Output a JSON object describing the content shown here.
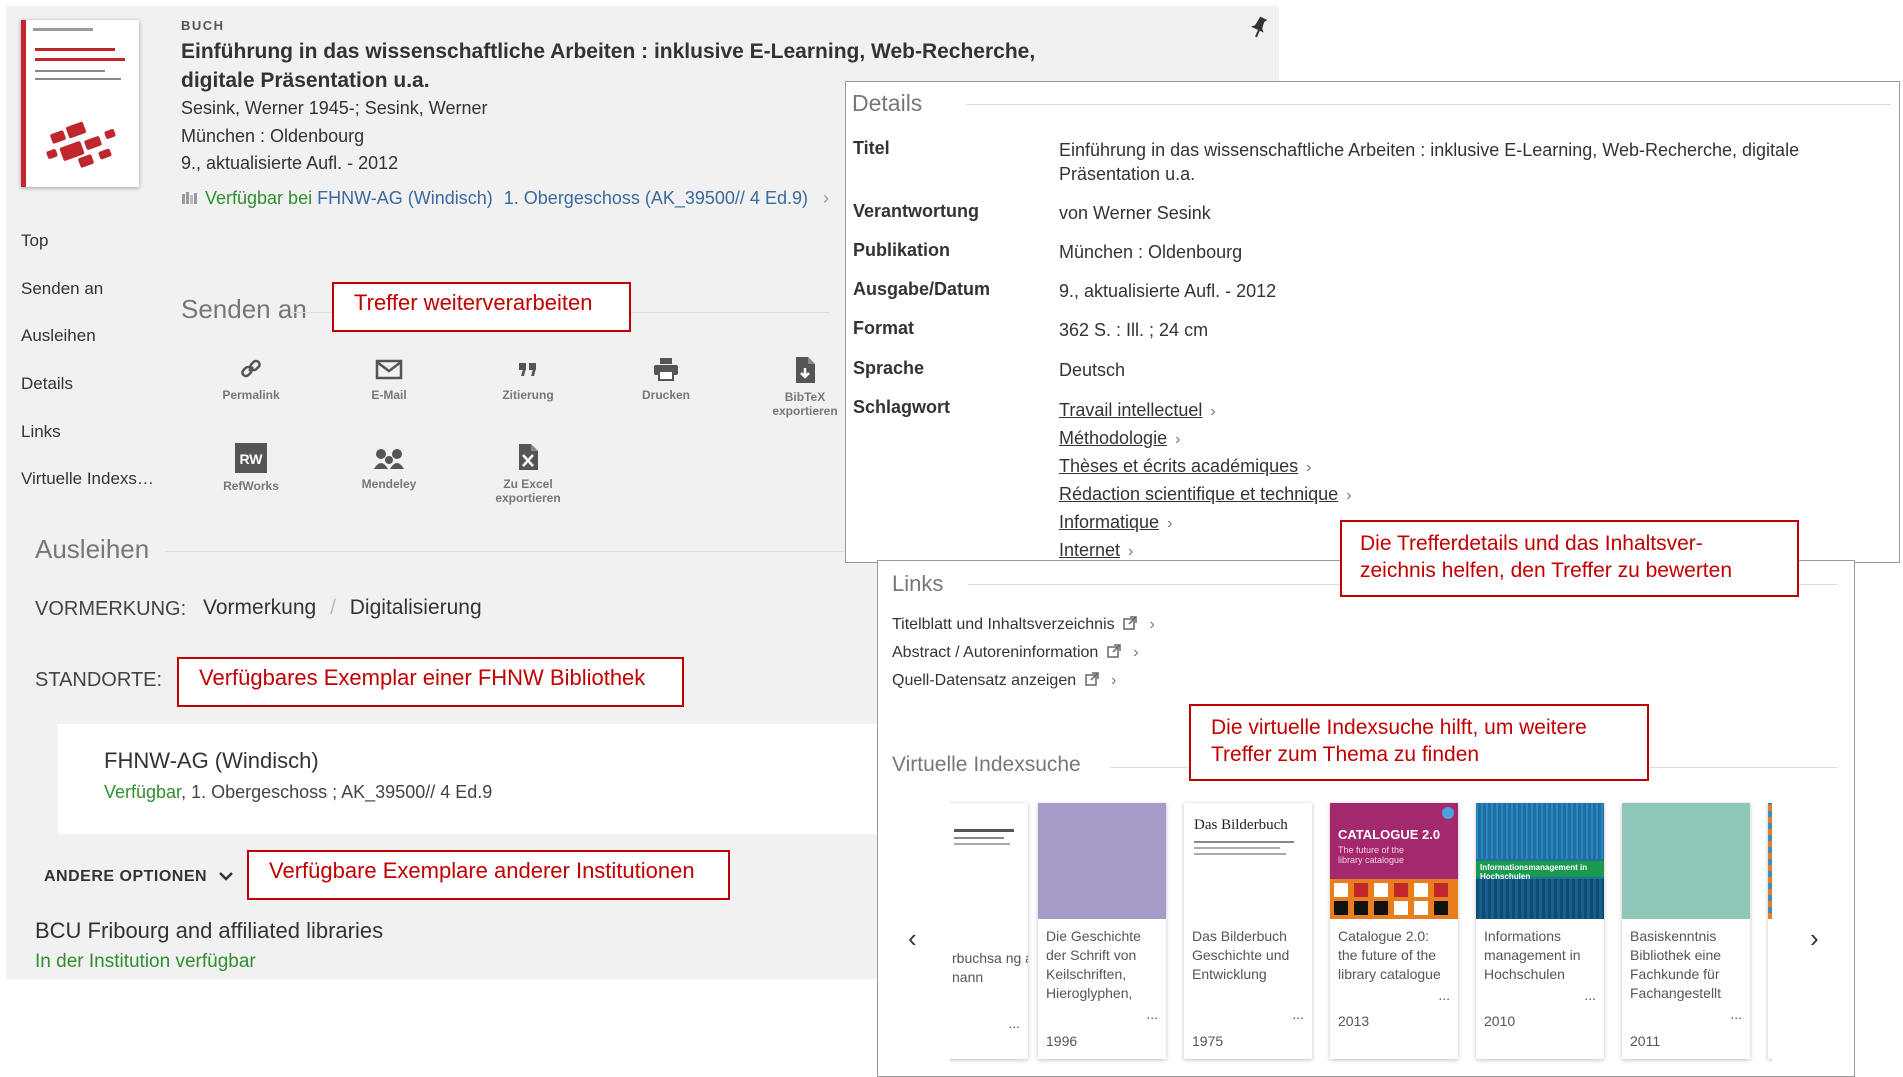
{
  "record": {
    "doc_type": "BUCH",
    "title": "Einführung in das wissenschaftliche Arbeiten : inklusive E-Learning, Web-Recherche, digitale Präsentation u.a.",
    "author": "Sesink, Werner 1945-; Sesink, Werner",
    "place": "München : Oldenbourg",
    "edition": "9., aktualisierte Aufl. - 2012",
    "availability": {
      "status": "Verfügbar bei",
      "library": "FHNW-AG (Windisch)",
      "location": "1. Obergeschoss (AK_39500// 4 Ed.9)"
    }
  },
  "nav": [
    "Top",
    "Senden an",
    "Ausleihen",
    "Details",
    "Links",
    "Virtuelle Indexs…"
  ],
  "send": {
    "heading": "Senden an",
    "actions": [
      {
        "label": "Permalink",
        "icon": "link-icon"
      },
      {
        "label": "E-Mail",
        "icon": "mail-icon"
      },
      {
        "label": "Zitierung",
        "icon": "quote-icon"
      },
      {
        "label": "Drucken",
        "icon": "print-icon"
      },
      {
        "label": "BibTeX",
        "label2": "exportieren",
        "icon": "bibtex-file-icon"
      },
      {
        "label": "RefWorks",
        "icon": "refworks-icon"
      },
      {
        "label": "Mendeley",
        "icon": "mendeley-icon"
      },
      {
        "label": "Zu Excel",
        "label2": "exportieren",
        "icon": "excel-file-icon"
      }
    ]
  },
  "lend": {
    "heading": "Ausleihen",
    "vormerkung_label": "VORMERKUNG:",
    "vormerkung": "Vormerkung",
    "digitalisierung": "Digitalisierung",
    "standorte_label": "STANDORTE:",
    "location_name": "FHNW-AG (Windisch)",
    "location_status": "Verfügbar",
    "location_detail": ", 1. Obergeschoss ; AK_39500// 4 Ed.9",
    "other_options": "ANDERE OPTIONEN",
    "other_library": "BCU Fribourg and affiliated libraries",
    "other_status": "In der Institution verfügbar"
  },
  "details": {
    "heading": "Details",
    "rows": [
      {
        "label": "Titel",
        "value": "Einführung in das wissenschaftliche Arbeiten : inklusive E-Learning, Web-Recherche, digitale Präsentation u.a."
      },
      {
        "label": "Verantwortung",
        "value": "von Werner Sesink"
      },
      {
        "label": "Publikation",
        "value": "München : Oldenbourg"
      },
      {
        "label": "Ausgabe/Datum",
        "value": "9., aktualisierte Aufl. - 2012"
      },
      {
        "label": "Format",
        "value": "362 S. : Ill. ; 24 cm"
      },
      {
        "label": "Sprache",
        "value": "Deutsch"
      },
      {
        "label": "Schlagwort",
        "value": ""
      }
    ],
    "subjects": [
      "Travail intellectuel",
      "Méthodologie",
      "Thèses et écrits académiques",
      "Rédaction scientifique et technique",
      "Informatique",
      "Internet"
    ]
  },
  "links": {
    "heading": "Links",
    "items": [
      "Titelblatt und Inhaltsverzeichnis",
      "Abstract / Autoreninformation",
      "Quell-Datensatz anzeigen"
    ]
  },
  "virtual": {
    "heading": "Virtuelle Indexsuche",
    "cards": [
      {
        "title": "rbuchsa ng a nann",
        "year": "",
        "cover": "#ffffff"
      },
      {
        "title": "Die Geschichte der Schrift von Keilschriften, Hieroglyphen,",
        "year": "1996",
        "cover": "#a79cc9"
      },
      {
        "title": "Das Bilderbuch Geschichte und Entwicklung",
        "year": "1975",
        "cover": "#ffffff"
      },
      {
        "title": "Catalogue 2.0: the future of the library catalogue",
        "year": "2013",
        "cover": "#a3286d"
      },
      {
        "title": "Informations management in Hochschulen",
        "year": "2010",
        "cover": "#1f6fa3"
      },
      {
        "title": "Basiskenntnis Bibliothek eine Fachkunde für Fachangestellt",
        "year": "2011",
        "cover": "#8fc7b9"
      }
    ],
    "cover_labels": {
      "catalogue_title": "CATALOGUE 2.0",
      "catalogue_sub": "The future of the library catalogue",
      "bilderbuch": "Das Bilderbuch",
      "info_mgmt": "Informationsmanagement in Hochschulen"
    }
  },
  "callouts": {
    "weiterverarbeiten": "Treffer weiterverarbeiten",
    "details_line1": "Die Trefferdetails und das Inhaltsver-",
    "details_line2": "zeichnis helfen, den Treffer zu bewerten",
    "fhnw": "Verfügbares Exemplar einer FHNW Bibliothek",
    "andere": "Verfügbare Exemplare anderer Institutionen",
    "virtuell_line1": "Die virtuelle Indexsuche hilft, um weitere",
    "virtuell_line2": "Treffer zum Thema zu finden"
  },
  "colors": {
    "accent_red": "#c00000",
    "available_green": "#2f8f2f",
    "link_blue": "#3a6a9e"
  }
}
